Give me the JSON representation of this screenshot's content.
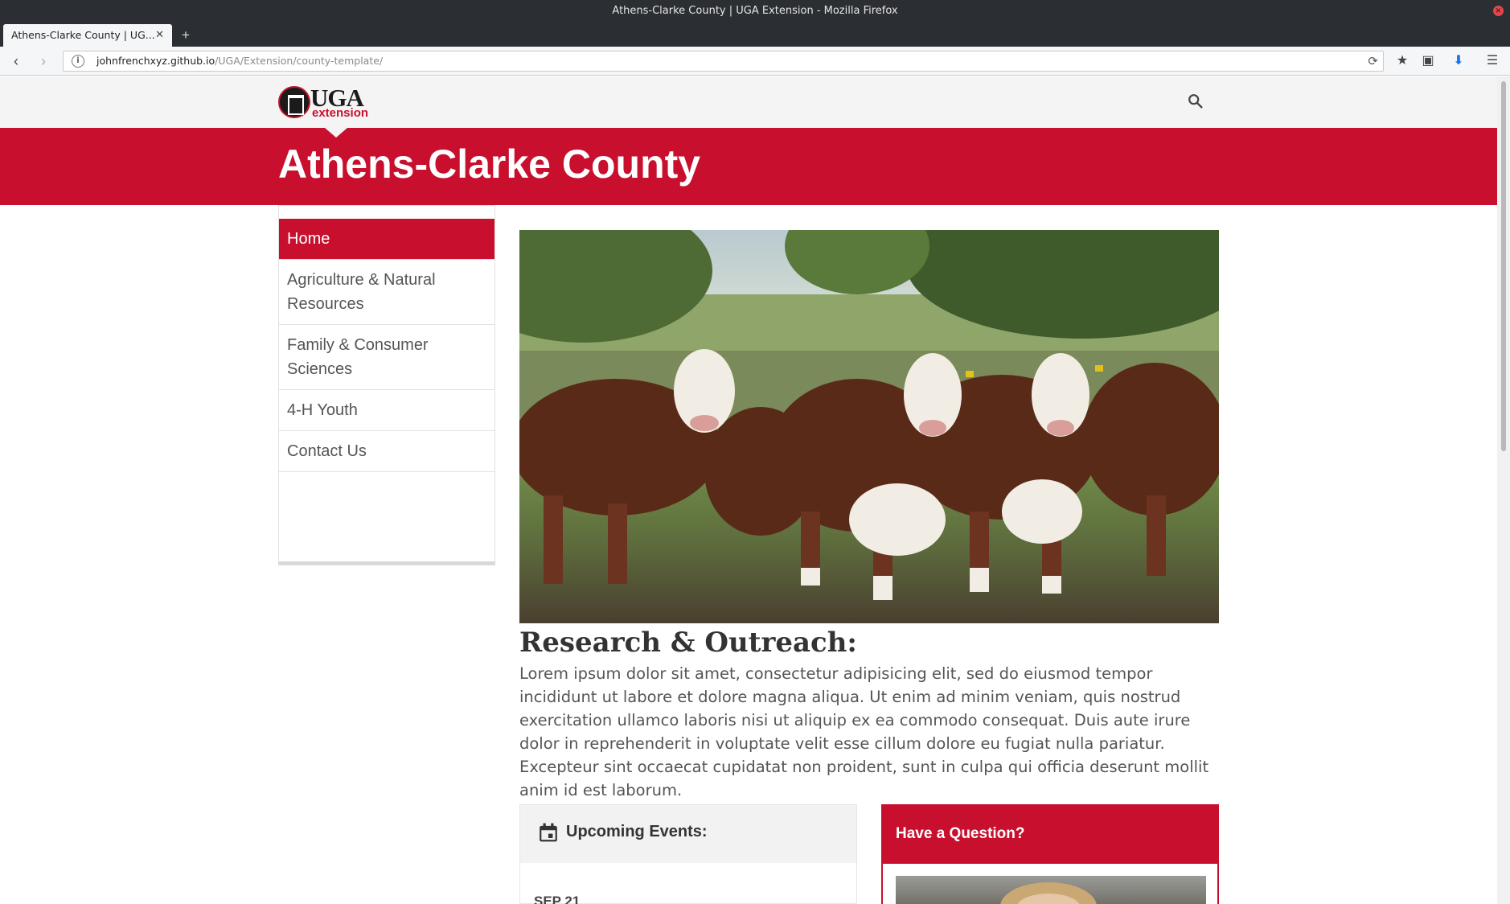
{
  "browser": {
    "window_title": "Athens-Clarke County | UGA Extension - Mozilla Firefox",
    "tab_title": "Athens-Clarke County | UG...",
    "url_host": "johnfrenchxyz.github.io",
    "url_path": "/UGA/Extension/county-template/"
  },
  "site": {
    "logo_main": "UGA",
    "logo_sub": "extension",
    "page_title": "Athens-Clarke County"
  },
  "sidebar": {
    "items": [
      {
        "label": "Home",
        "active": true
      },
      {
        "label": "Agriculture & Natural Resources",
        "active": false
      },
      {
        "label": "Family & Consumer Sciences",
        "active": false
      },
      {
        "label": "4-H Youth",
        "active": false
      },
      {
        "label": "Contact Us",
        "active": false
      }
    ]
  },
  "main": {
    "section_title": "Research & Outreach:",
    "section_body": "Lorem ipsum dolor sit amet, consectetur adipisicing elit, sed do eiusmod tempor incididunt ut labore et dolore magna aliqua. Ut enim ad minim veniam, quis nostrud exercitation ullamco laboris nisi ut aliquip ex ea commodo consequat. Duis aute irure dolor in reprehenderit in voluptate velit esse cillum dolore eu fugiat nulla pariatur. Excepteur sint occaecat cupidatat non proident, sunt in culpa qui officia deserunt mollit anim id est laborum.",
    "events": {
      "title": "Upcoming Events:",
      "first_date": "SEP 21"
    },
    "question": {
      "title": "Have a Question?"
    }
  },
  "colors": {
    "brand_red": "#c8102e",
    "header_gray": "#f4f4f4"
  },
  "icons": [
    "back-icon",
    "forward-icon",
    "info-icon",
    "reload-icon",
    "bookmark-star-icon",
    "pocket-icon",
    "download-icon",
    "menu-icon",
    "search-icon",
    "calendar-icon"
  ]
}
